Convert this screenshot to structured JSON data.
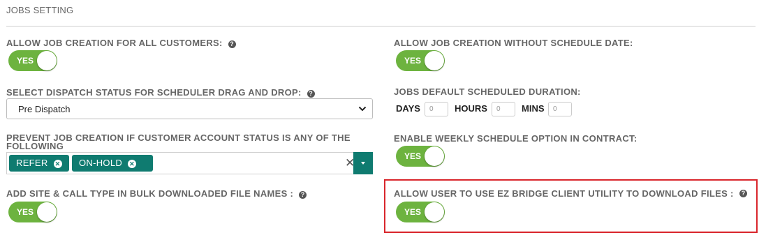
{
  "section": {
    "title": "JOBS SETTING"
  },
  "settings": {
    "allow_job_creation": {
      "label": "ALLOW JOB CREATION FOR ALL CUSTOMERS:",
      "toggle": "YES"
    },
    "without_schedule_date": {
      "label": "ALLOW JOB CREATION WITHOUT SCHEDULE DATE:",
      "toggle": "YES"
    },
    "dispatch_status": {
      "label": "SELECT DISPATCH STATUS FOR SCHEDULER DRAG AND DROP:",
      "selected": "Pre Dispatch"
    },
    "default_duration": {
      "label": "JOBS DEFAULT SCHEDULED DURATION:",
      "days_label": "DAYS",
      "days_placeholder": "0",
      "hours_label": "HOURS",
      "hours_placeholder": "0",
      "mins_label": "MINS",
      "mins_placeholder": "0"
    },
    "prevent_creation": {
      "label": "PREVENT JOB CREATION IF CUSTOMER ACCOUNT STATUS IS ANY OF THE FOLLOWING",
      "tags": [
        "REFER",
        "ON-HOLD"
      ]
    },
    "weekly_schedule": {
      "label": "ENABLE WEEKLY SCHEDULE OPTION IN CONTRACT:",
      "toggle": "YES"
    },
    "bulk_download_names": {
      "label": "ADD SITE & CALL TYPE IN BULK DOWNLOADED FILE NAMES :",
      "toggle": "YES"
    },
    "ez_bridge": {
      "label": "ALLOW USER TO USE EZ BRIDGE CLIENT UTILITY TO DOWNLOAD FILES :",
      "toggle": "YES"
    }
  },
  "icons": {
    "help": "?",
    "tag_remove": "✕",
    "clear": "✕"
  },
  "colors": {
    "toggle_on": "#6db33f",
    "tag": "#0f7b70",
    "highlight": "#d9262c"
  }
}
